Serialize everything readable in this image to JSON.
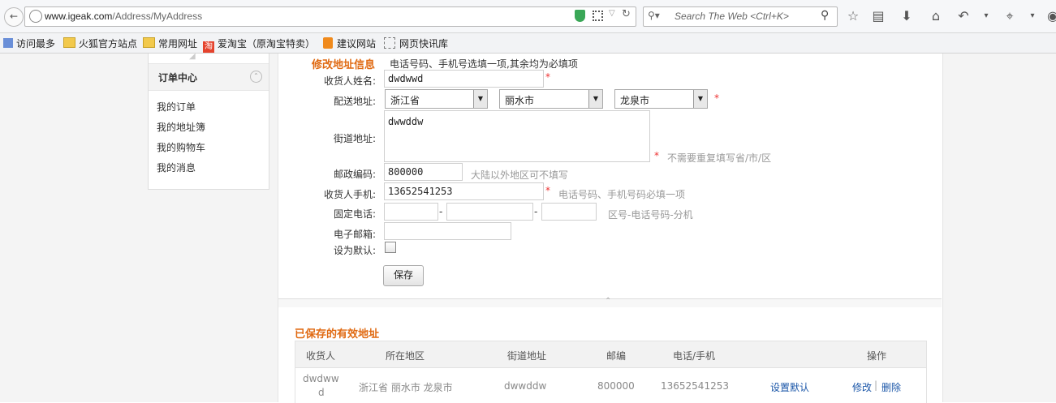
{
  "browser": {
    "url_host": "www.igeak.com",
    "url_path": "/Address/MyAddress",
    "search_placeholder": "Search The Web <Ctrl+K>"
  },
  "bookmarks": [
    "访问最多",
    "火狐官方站点",
    "常用网址",
    "爱淘宝（原淘宝特卖）",
    "建议网站",
    "网页快讯库"
  ],
  "sidebar": {
    "title": "订单中心",
    "items": [
      "我的订单",
      "我的地址簿",
      "我的购物车",
      "我的消息"
    ]
  },
  "form": {
    "title": "修改地址信息",
    "note": "电话号码、手机号选填一项,其余均为必填项",
    "name_label": "收货人姓名:",
    "name_value": "dwdwwd",
    "addr_label": "配送地址:",
    "province": "浙江省",
    "city": "丽水市",
    "district": "龙泉市",
    "street_label": "街道地址:",
    "street_value": "dwwddw",
    "street_hint": "不需要重复填写省/市/区",
    "zip_label": "邮政编码:",
    "zip_value": "800000",
    "zip_hint": "大陆以外地区可不填写",
    "mobile_label": "收货人手机:",
    "mobile_value": "13652541253",
    "mobile_hint": "电话号码、手机号码必填一项",
    "phone_label": "固定电话:",
    "phone_sep": "-",
    "phone_hint": "区号-电话号码-分机",
    "email_label": "电子邮箱:",
    "default_label": "设为默认:",
    "save_label": "保存",
    "required_mark": "*"
  },
  "saved": {
    "title": "已保存的有效地址",
    "headers": [
      "收货人",
      "所在地区",
      "街道地址",
      "邮编",
      "电话/手机",
      "操作"
    ],
    "rows": [
      {
        "name_line1": "dwdww",
        "name_line2": "d",
        "region": "浙江省 丽水市 龙泉市",
        "street": "dwwddw",
        "zip": "800000",
        "phone": "13652541253",
        "set_default": "设置默认",
        "edit": "修改",
        "sep": "|",
        "delete": "删除"
      }
    ]
  },
  "colors": {
    "accent_orange": "#e06a12",
    "link_blue": "#1a56a8",
    "required_red": "#e33333"
  }
}
